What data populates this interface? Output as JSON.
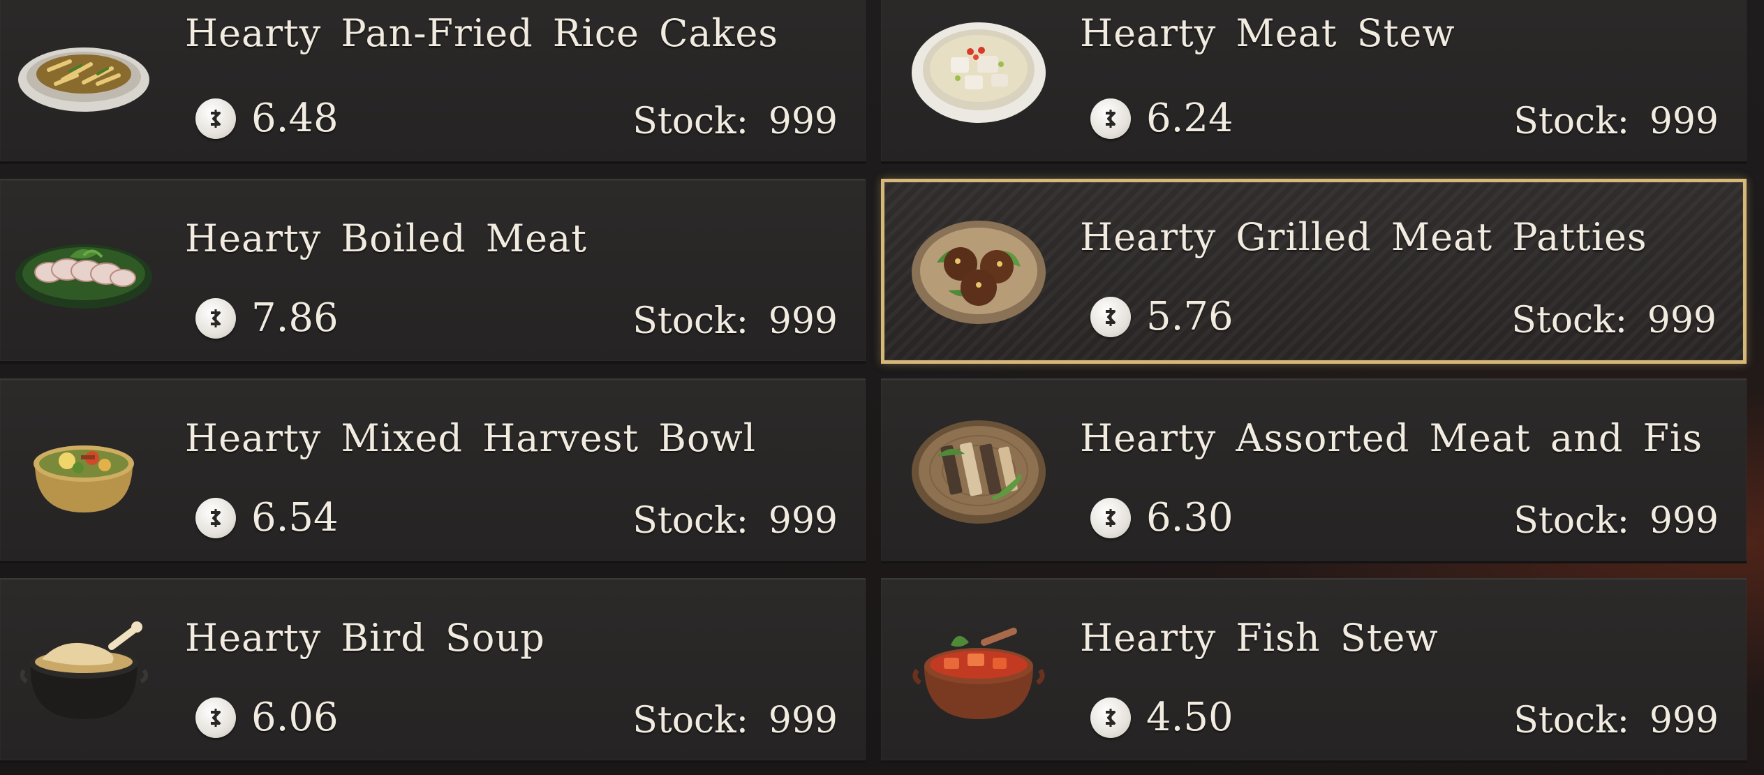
{
  "shop": {
    "items": [
      {
        "name": "Hearty Pan-Fried Rice Cakes",
        "price": "6.48",
        "stock_label": "Stock:",
        "stock_value": "999",
        "icon": "rice-cakes-icon",
        "selected": false
      },
      {
        "name": "Hearty Meat Stew",
        "price": "6.24",
        "stock_label": "Stock:",
        "stock_value": "999",
        "icon": "meat-stew-icon",
        "selected": false
      },
      {
        "name": "Hearty Boiled Meat",
        "price": "7.86",
        "stock_label": "Stock:",
        "stock_value": "999",
        "icon": "boiled-meat-icon",
        "selected": false
      },
      {
        "name": "Hearty Grilled Meat Patties",
        "price": "5.76",
        "stock_label": "Stock:",
        "stock_value": "999",
        "icon": "meat-patties-icon",
        "selected": true
      },
      {
        "name": "Hearty Mixed Harvest Bowl",
        "price": "6.54",
        "stock_label": "Stock:",
        "stock_value": "999",
        "icon": "harvest-bowl-icon",
        "selected": false
      },
      {
        "name": "Hearty Assorted Meat and Fis",
        "price": "6.30",
        "stock_label": "Stock:",
        "stock_value": "999",
        "icon": "meat-fish-platter-icon",
        "selected": false
      },
      {
        "name": "Hearty Bird Soup",
        "price": "6.06",
        "stock_label": "Stock:",
        "stock_value": "999",
        "icon": "bird-soup-icon",
        "selected": false
      },
      {
        "name": "Hearty Fish Stew",
        "price": "4.50",
        "stock_label": "Stock:",
        "stock_value": "999",
        "icon": "fish-stew-icon",
        "selected": false
      }
    ],
    "currency_icon": "coin-icon",
    "colors": {
      "text": "#f1ebe0",
      "card": "#2a2827",
      "selected_border": "#d6b878",
      "background": "#1a1818"
    }
  }
}
